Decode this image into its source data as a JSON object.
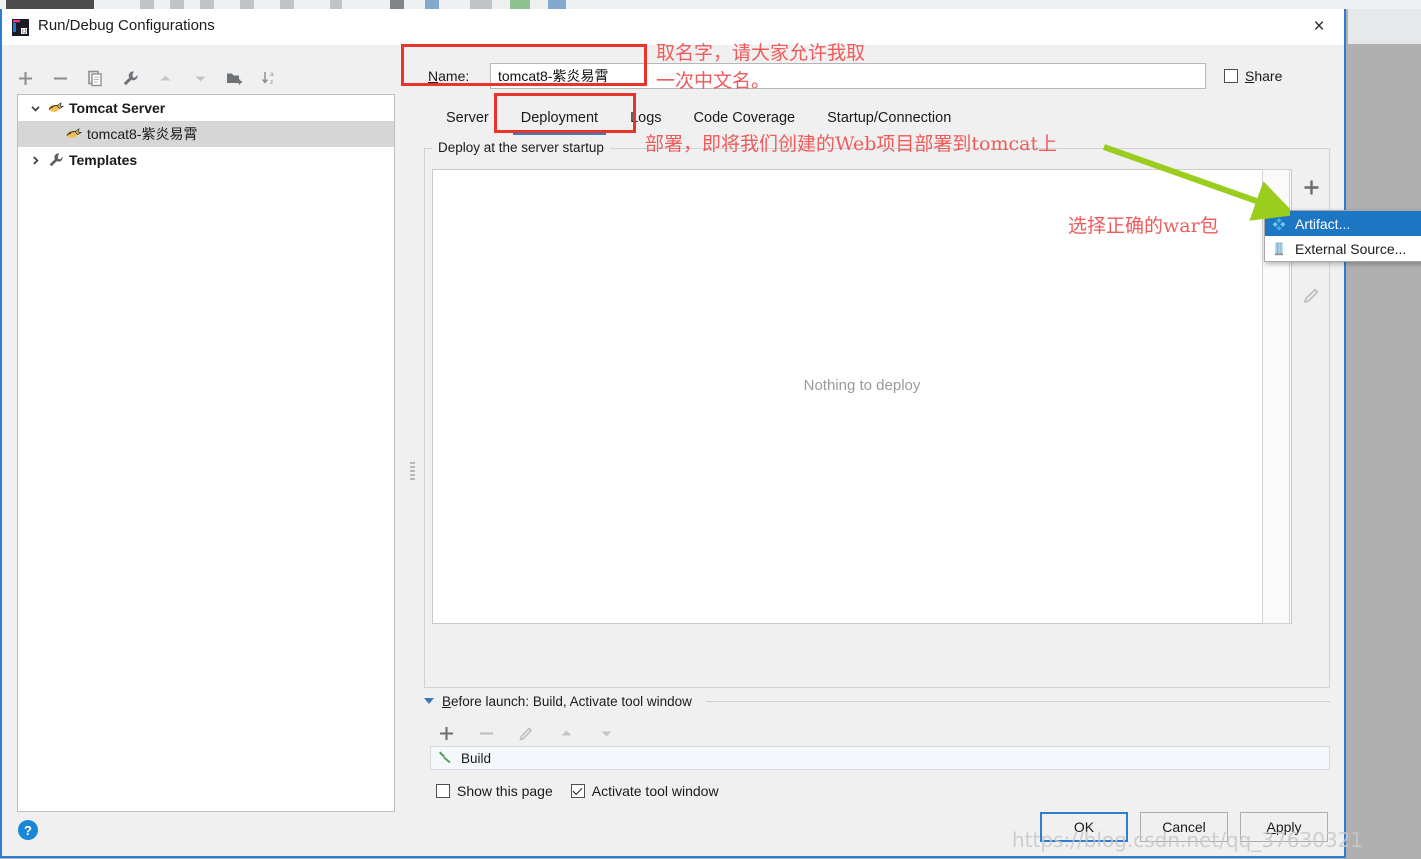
{
  "window": {
    "title": "Run/Debug Configurations",
    "close_label": "×",
    "app_icon": "intellij-idea-icon"
  },
  "sidebar": {
    "toolbar": [
      {
        "name": "add-configuration-button",
        "icon": "plus-icon",
        "label": "+"
      },
      {
        "name": "remove-configuration-button",
        "icon": "minus-icon",
        "label": "−"
      },
      {
        "name": "copy-configuration-button",
        "icon": "copy-icon",
        "label": ""
      },
      {
        "name": "edit-templates-button",
        "icon": "wrench-icon",
        "label": ""
      },
      {
        "name": "move-up-button",
        "icon": "arrow-up-icon",
        "label": ""
      },
      {
        "name": "move-down-button",
        "icon": "arrow-down-icon",
        "label": ""
      },
      {
        "name": "new-folder-button",
        "icon": "folder-add-icon",
        "label": ""
      },
      {
        "name": "sort-configurations-button",
        "icon": "sort-az-icon",
        "label": ""
      }
    ],
    "tree": [
      {
        "label": "Tomcat Server",
        "icon": "tomcat-icon",
        "twisty": "expanded",
        "indent": 0,
        "selected": false,
        "bold": true
      },
      {
        "label": "tomcat8-紫炎易霄",
        "icon": "tomcat-icon",
        "twisty": "none",
        "indent": 1,
        "selected": true,
        "bold": false
      },
      {
        "label": "Templates",
        "icon": "wrench-icon",
        "twisty": "collapsed",
        "indent": 0,
        "selected": false,
        "bold": true
      }
    ],
    "help_label": "?"
  },
  "form": {
    "name_label_prefix": "N",
    "name_label_rest": "ame:",
    "name_value": "tomcat8-紫炎易霄",
    "name_placeholder": "",
    "share_label": "Share",
    "share_checked": false
  },
  "tabs": [
    {
      "label": "Server",
      "active": false
    },
    {
      "label": "Deployment",
      "active": true
    },
    {
      "label": "Logs",
      "active": false
    },
    {
      "label": "Code Coverage",
      "active": false
    },
    {
      "label": "Startup/Connection",
      "active": false
    }
  ],
  "deployment": {
    "group_title": "Deploy at the server startup",
    "empty_text": "Nothing to deploy",
    "buttons": [
      {
        "name": "add-artifact-button",
        "icon": "plus-icon",
        "label": "+",
        "enabled": true
      },
      {
        "name": "remove-artifact-button",
        "icon": "minus-icon",
        "label": "−",
        "enabled": false
      },
      {
        "name": "move-down-artifact-button",
        "icon": "arrow-down-icon",
        "label": "▼",
        "enabled": false
      },
      {
        "name": "edit-artifact-button",
        "icon": "pencil-icon",
        "label": "✎",
        "enabled": false
      }
    ]
  },
  "popup_menu": {
    "items": [
      {
        "label": "Artifact...",
        "icon": "artifact-icon",
        "selected": true
      },
      {
        "label": "External Source...",
        "icon": "external-source-icon",
        "selected": false
      }
    ]
  },
  "before_launch": {
    "title_prefix": "B",
    "title_rest": "efore launch: Build, Activate tool window",
    "toolbar": [
      {
        "name": "add-task-button",
        "icon": "plus-icon",
        "label": "+",
        "enabled": true
      },
      {
        "name": "remove-task-button",
        "icon": "minus-icon",
        "label": "−",
        "enabled": false
      },
      {
        "name": "edit-task-button",
        "icon": "pencil-icon",
        "label": "✎",
        "enabled": false
      },
      {
        "name": "move-task-up-button",
        "icon": "arrow-up-icon",
        "label": "▲",
        "enabled": false
      },
      {
        "name": "move-task-down-button",
        "icon": "arrow-down-icon",
        "label": "▼",
        "enabled": false
      }
    ],
    "task": {
      "label": "Build",
      "icon": "build-hammer-icon"
    },
    "show_page_label": "Show this page",
    "show_page_checked": false,
    "activate_window_label": "Activate tool window",
    "activate_window_checked": true
  },
  "footer": {
    "ok_label": "OK",
    "cancel_label": "Cancel",
    "apply_prefix": "A",
    "apply_rest": "pply"
  },
  "annotations": {
    "name_note_line1": "取名字，请大家允许我取",
    "name_note_line2": "一次中文名。",
    "deploy_note": "部署，即将我们创建的Web项目部署到tomcat上",
    "war_note": "选择正确的war包",
    "arrow_color": "#9acd1e",
    "box_color": "#e8342a",
    "text_color": "#ef5a5a"
  },
  "watermark": {
    "text": "https://blog.csdn.net/qq_37630321"
  }
}
